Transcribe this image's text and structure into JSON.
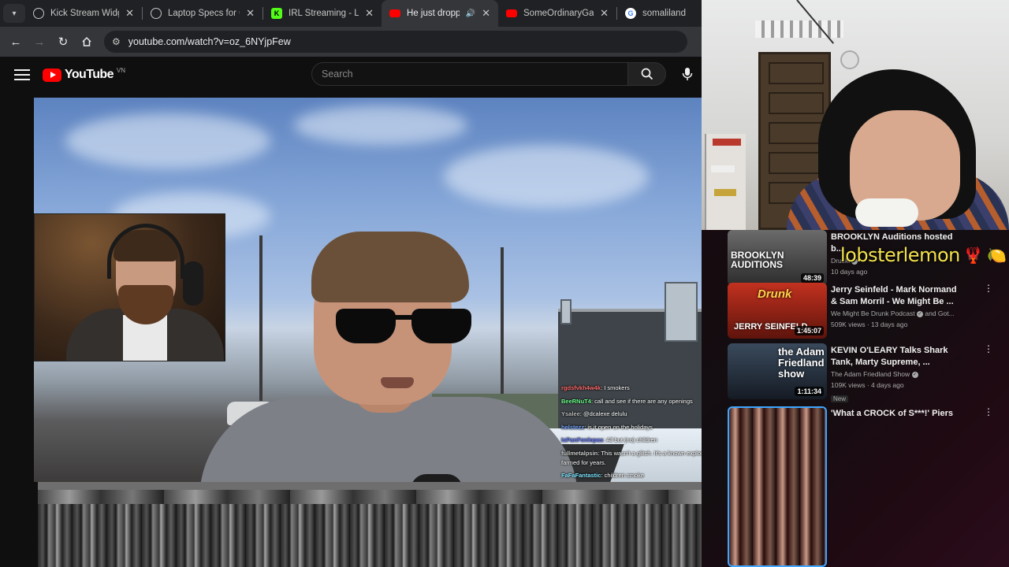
{
  "browser": {
    "tab_menu_icon": "chevron-down-icon",
    "tabs": [
      {
        "title": "Kick Stream Widgets",
        "favicon": "globe-icon",
        "active": false
      },
      {
        "title": "Laptop Specs for Gri",
        "favicon": "globe-icon",
        "active": false
      },
      {
        "title": "IRL Streaming - Live",
        "favicon": "kick-icon",
        "active": false
      },
      {
        "title": "He just dropped",
        "favicon": "youtube-icon",
        "active": true,
        "audio": true
      },
      {
        "title": "SomeOrdinaryGame",
        "favicon": "youtube-icon",
        "active": false
      },
      {
        "title": "somaliland - Go",
        "favicon": "google-icon",
        "active": false
      }
    ],
    "url": "youtube.com/watch?v=oz_6NYjpFew"
  },
  "youtube": {
    "logo_text": "YouTube",
    "region": "VN",
    "search_placeholder": "Search"
  },
  "chat": [
    {
      "user": "rgdsfvkh4w4k",
      "message": "I smokers",
      "color": "#ff6b6b"
    },
    {
      "user": "BeeRNuT4",
      "message": "call and see if there are any openings",
      "color": "#6bff8a"
    },
    {
      "user": "Ysalee",
      "message": "@dcalexe delulu",
      "color": "#bbbbbb"
    },
    {
      "user": "helstezz",
      "message": "is it open on the holidays",
      "color": "#7aa8ff"
    },
    {
      "user": "IsPanFonlopas",
      "message": "All but (no) children",
      "color": "#6a7dff"
    },
    {
      "user": "fullmetalpsin",
      "message": "This wasn't a glitch. It's a known exploit farmed for years.",
      "color": "#cccccc"
    },
    {
      "user": "FaFaFantastic",
      "message": "children smoke",
      "color": "#7ce4ff"
    }
  ],
  "overlay": {
    "name": "lobsterlemon",
    "emojis": [
      "🦞",
      "🍋"
    ]
  },
  "recommendations": [
    {
      "title": "BROOKLYN Auditions hosted b...",
      "channel": "Druski",
      "meta": "10 days ago",
      "duration": "48:39",
      "thumb_text": "BROOKLYN AUDITIONS"
    },
    {
      "title": "Jerry Seinfeld - Mark Normand & Sam Morril - We Might Be ...",
      "channel": "We Might Be Drunk Podcast",
      "channel_suffix": "and Got...",
      "meta": "509K views · 13 days ago",
      "duration": "1:45:07",
      "thumb_text": "JERRY SEINFELD",
      "thumb_brand": "Drunk"
    },
    {
      "title": "KEVIN O'LEARY Talks Shark Tank, Marty Supreme, ...",
      "channel": "The Adam Friedland Show",
      "meta": "109K views · 4 days ago",
      "badge": "New",
      "duration": "1:11:34",
      "thumb_text": "the Adam Friedland show"
    },
    {
      "title": "'What a CROCK of S***!' Piers"
    }
  ],
  "colors": {
    "youtube_red": "#ff0000",
    "overlay_yellow": "#f4e24c"
  }
}
